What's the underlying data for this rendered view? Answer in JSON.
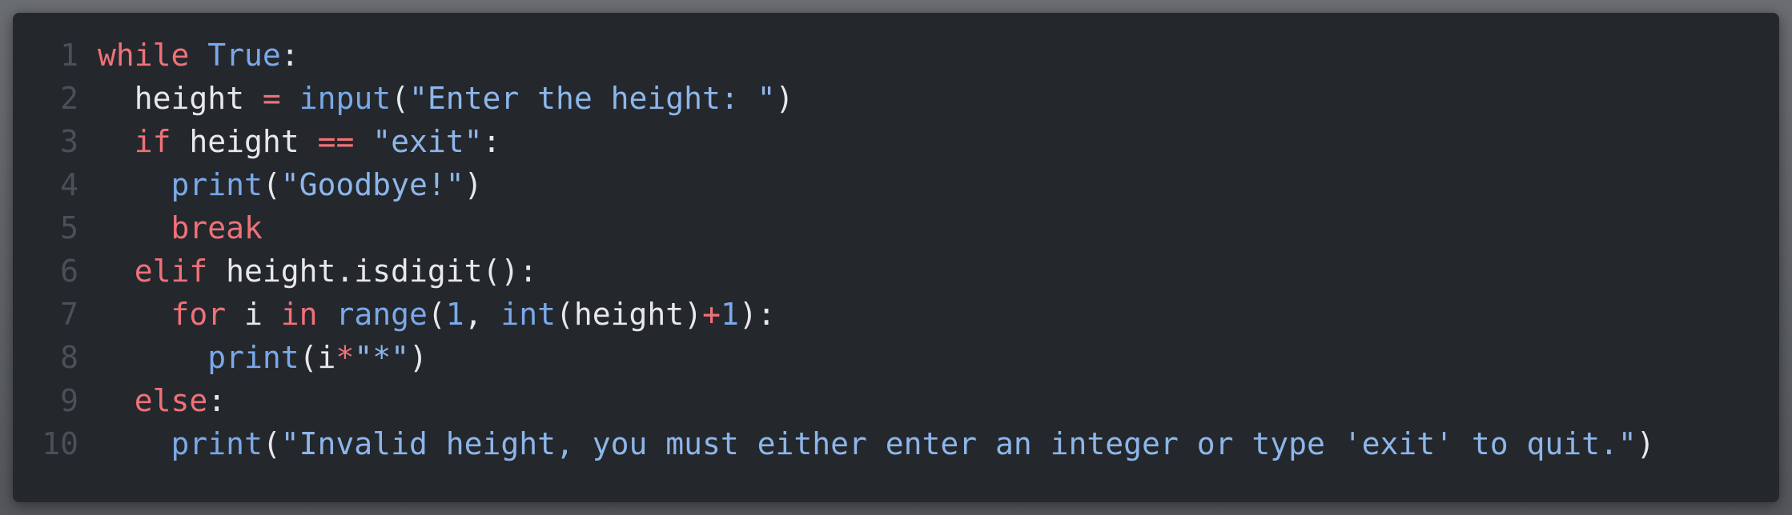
{
  "theme": {
    "background": "#24282d",
    "line_number_color": "#4a5058",
    "keyword_color": "#f07178",
    "function_color": "#7aa9e8",
    "string_color": "#8db6ea",
    "plain_color": "#e6e8eb"
  },
  "lines": [
    {
      "num": "1",
      "indent": "",
      "tokens": [
        {
          "t": "kw",
          "v": "while"
        },
        {
          "t": "pl",
          "v": " "
        },
        {
          "t": "fn",
          "v": "True"
        },
        {
          "t": "pl",
          "v": ":"
        }
      ]
    },
    {
      "num": "2",
      "indent": "  ",
      "tokens": [
        {
          "t": "pl",
          "v": "height "
        },
        {
          "t": "op",
          "v": "="
        },
        {
          "t": "pl",
          "v": " "
        },
        {
          "t": "fn",
          "v": "input"
        },
        {
          "t": "pl",
          "v": "("
        },
        {
          "t": "str",
          "v": "\"Enter the height: \""
        },
        {
          "t": "pl",
          "v": ")"
        }
      ]
    },
    {
      "num": "3",
      "indent": "  ",
      "tokens": [
        {
          "t": "kw",
          "v": "if"
        },
        {
          "t": "pl",
          "v": " height "
        },
        {
          "t": "op",
          "v": "=="
        },
        {
          "t": "pl",
          "v": " "
        },
        {
          "t": "str",
          "v": "\"exit\""
        },
        {
          "t": "pl",
          "v": ":"
        }
      ]
    },
    {
      "num": "4",
      "indent": "    ",
      "tokens": [
        {
          "t": "fn",
          "v": "print"
        },
        {
          "t": "pl",
          "v": "("
        },
        {
          "t": "str",
          "v": "\"Goodbye!\""
        },
        {
          "t": "pl",
          "v": ")"
        }
      ]
    },
    {
      "num": "5",
      "indent": "    ",
      "tokens": [
        {
          "t": "kw",
          "v": "break"
        }
      ]
    },
    {
      "num": "6",
      "indent": "  ",
      "tokens": [
        {
          "t": "kw",
          "v": "elif"
        },
        {
          "t": "pl",
          "v": " height.isdigit():"
        }
      ]
    },
    {
      "num": "7",
      "indent": "    ",
      "tokens": [
        {
          "t": "kw",
          "v": "for"
        },
        {
          "t": "pl",
          "v": " i "
        },
        {
          "t": "kw",
          "v": "in"
        },
        {
          "t": "pl",
          "v": " "
        },
        {
          "t": "fn",
          "v": "range"
        },
        {
          "t": "pl",
          "v": "("
        },
        {
          "t": "num",
          "v": "1"
        },
        {
          "t": "pl",
          "v": ", "
        },
        {
          "t": "fn",
          "v": "int"
        },
        {
          "t": "pl",
          "v": "(height)"
        },
        {
          "t": "op",
          "v": "+"
        },
        {
          "t": "num",
          "v": "1"
        },
        {
          "t": "pl",
          "v": "):"
        }
      ]
    },
    {
      "num": "8",
      "indent": "      ",
      "tokens": [
        {
          "t": "fn",
          "v": "print"
        },
        {
          "t": "pl",
          "v": "(i"
        },
        {
          "t": "op",
          "v": "*"
        },
        {
          "t": "str",
          "v": "\"*\""
        },
        {
          "t": "pl",
          "v": ")"
        }
      ]
    },
    {
      "num": "9",
      "indent": "  ",
      "tokens": [
        {
          "t": "kw",
          "v": "else"
        },
        {
          "t": "pl",
          "v": ":"
        }
      ]
    },
    {
      "num": "10",
      "indent": "    ",
      "tokens": [
        {
          "t": "fn",
          "v": "print"
        },
        {
          "t": "pl",
          "v": "("
        },
        {
          "t": "str",
          "v": "\"Invalid height, you must either enter an integer or type 'exit' to quit.\""
        },
        {
          "t": "pl",
          "v": ")"
        }
      ]
    }
  ]
}
